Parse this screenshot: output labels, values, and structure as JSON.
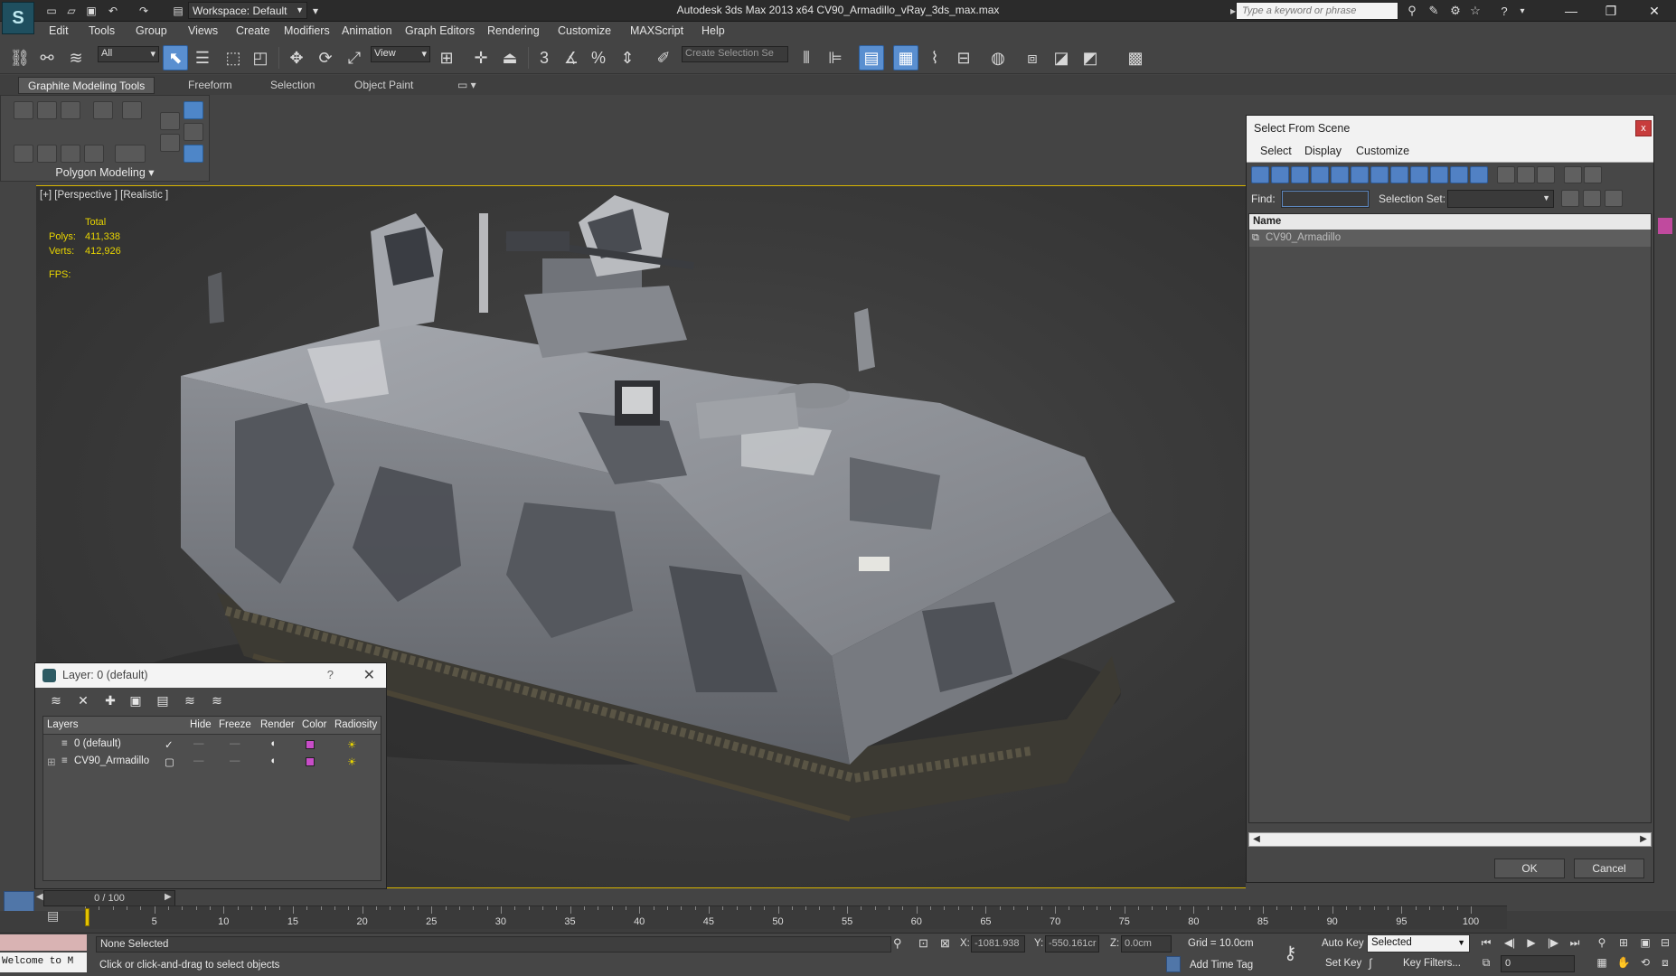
{
  "titlebar": {
    "workspace": "Workspace: Default",
    "title": "Autodesk 3ds Max  2013 x64     CV90_Armadillo_vRay_3ds_max.max",
    "search_placeholder": "Type a keyword or phrase"
  },
  "menu": [
    "Edit",
    "Tools",
    "Group",
    "Views",
    "Create",
    "Modifiers",
    "Animation",
    "Graph Editors",
    "Rendering",
    "Customize",
    "MAXScript",
    "Help"
  ],
  "toolbar": {
    "filter_value": "All",
    "ref_coord_value": "View",
    "selection_set_placeholder": "Create Selection Se"
  },
  "ribbon": {
    "tabs": [
      "Graphite Modeling Tools",
      "Freeform",
      "Selection",
      "Object Paint"
    ],
    "panel_label": "Polygon Modeling"
  },
  "viewport": {
    "label": "[+] [Perspective ] [Realistic ]",
    "stats_total": "Total",
    "polys_label": "Polys:",
    "polys_value": "411,338",
    "verts_label": "Verts:",
    "verts_value": "412,926",
    "fps_label": "FPS:"
  },
  "scene_dialog": {
    "title": "Select From Scene",
    "close": "x",
    "menu": [
      "Select",
      "Display",
      "Customize"
    ],
    "find_label": "Find:",
    "selection_set_label": "Selection Set:",
    "column_name": "Name",
    "rows": [
      "CV90_Armadillo"
    ],
    "ok": "OK",
    "cancel": "Cancel"
  },
  "layer_dialog": {
    "title": "Layer: 0 (default)",
    "help": "?",
    "close": "✕",
    "headers": [
      "Layers",
      "Hide",
      "Freeze",
      "Render",
      "Color",
      "Radiosity"
    ],
    "rows": [
      {
        "name": "0 (default)",
        "active": "✓"
      },
      {
        "name": "CV90_Armadillo",
        "active": "▢"
      }
    ],
    "color_swatch": "#c84dc8"
  },
  "timeline": {
    "slider_text": "0 / 100",
    "ticks": [
      "5",
      "10",
      "15",
      "20",
      "25",
      "30",
      "35",
      "40",
      "45",
      "50",
      "55",
      "60",
      "65",
      "70",
      "75",
      "80",
      "85",
      "90",
      "95",
      "100"
    ]
  },
  "status": {
    "welcome": "Welcome to M",
    "selection": "None Selected",
    "prompt": "Click or click-and-drag to select objects",
    "x_label": "X:",
    "x_value": "-1081.938",
    "y_label": "Y:",
    "y_value": "-550.161cr",
    "z_label": "Z:",
    "z_value": "0.0cm",
    "grid": "Grid = 10.0cm",
    "add_time_tag": "Add Time Tag",
    "auto_key": "Auto Key",
    "set_key": "Set Key",
    "selected": "Selected",
    "key_filters": "Key Filters...",
    "frame": "0"
  },
  "colors": {
    "accent_blue": "#5a8fd0",
    "viewport_border": "#d9b600",
    "stats_yellow": "#e8d400"
  }
}
